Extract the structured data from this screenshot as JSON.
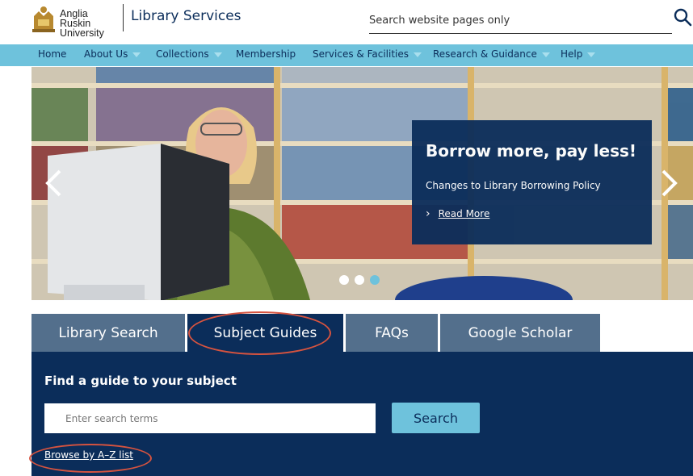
{
  "header": {
    "logo_line1": "Anglia Ruskin",
    "logo_line2": "University",
    "site_title": "Library Services",
    "search_placeholder": "Search website pages only",
    "search_icon": "search-icon"
  },
  "nav": {
    "items": [
      {
        "label": "Home",
        "dropdown": false
      },
      {
        "label": "About Us",
        "dropdown": true
      },
      {
        "label": "Collections",
        "dropdown": true
      },
      {
        "label": "Membership",
        "dropdown": false
      },
      {
        "label": "Services & Facilities",
        "dropdown": true
      },
      {
        "label": "Research & Guidance",
        "dropdown": true
      },
      {
        "label": "Help",
        "dropdown": true
      }
    ]
  },
  "hero": {
    "title": "Borrow more, pay less!",
    "subtitle": "Changes to Library Borrowing Policy",
    "link_label": "Read More",
    "active_slide": 2,
    "slide_count": 3
  },
  "tabs": [
    {
      "label": "Library Search",
      "active": false
    },
    {
      "label": "Subject Guides",
      "active": true
    },
    {
      "label": "FAQs",
      "active": false
    },
    {
      "label": "Google Scholar",
      "active": false
    }
  ],
  "panel": {
    "title": "Find a guide to your subject",
    "input_placeholder": "Enter search terms",
    "button_label": "Search",
    "browse_link": "Browse by A–Z list"
  },
  "colors": {
    "navy": "#0b2d5a",
    "nav_blue": "#6ec2dc",
    "tab_inactive": "#536f8c",
    "annotation_red": "#d6533f"
  }
}
